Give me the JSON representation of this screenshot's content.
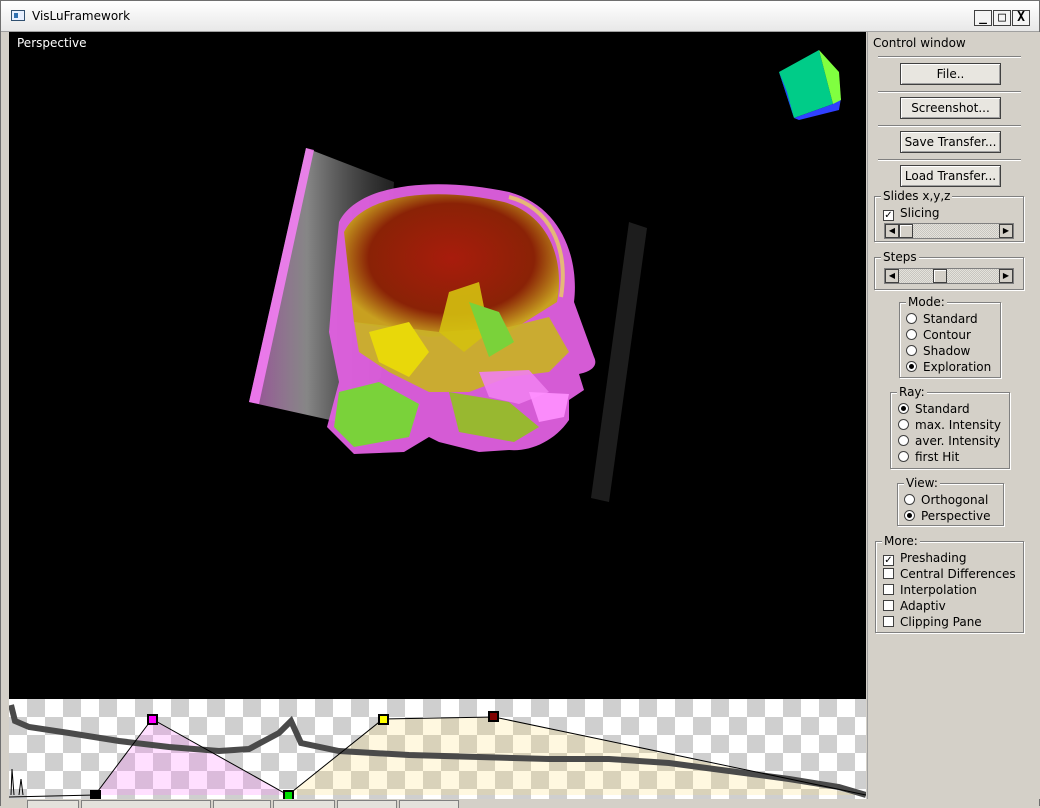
{
  "window": {
    "title": "VisLuFramework",
    "minimize": "_",
    "maximize": "□",
    "close": "X"
  },
  "viewport": {
    "label": "Perspective"
  },
  "panel": {
    "title": "Control window",
    "buttons": {
      "file": "File..",
      "screenshot": "Screenshot...",
      "save_transfer": "Save Transfer...",
      "load_transfer": "Load Transfer..."
    },
    "slides": {
      "title": "Slides x,y,z",
      "slicing_label": "Slicing",
      "slicing_checked": true,
      "slider_value": 0.0
    },
    "steps": {
      "title": "Steps",
      "slider_value": 0.42
    },
    "mode": {
      "title": "Mode:",
      "options": [
        "Standard",
        "Contour",
        "Shadow",
        "Exploration"
      ],
      "selected": "Exploration"
    },
    "ray": {
      "title": "Ray:",
      "options": [
        "Standard",
        "max. Intensity",
        "aver. Intensity",
        "first Hit"
      ],
      "selected": "Standard"
    },
    "view": {
      "title": "View:",
      "options": [
        "Orthogonal",
        "Perspective"
      ],
      "selected": "Perspective"
    },
    "more": {
      "title": "More:",
      "options": [
        "Preshading",
        "Central Differences",
        "Interpolation",
        "Adaptiv",
        "Clipping Pane"
      ],
      "checked": [
        "Preshading"
      ]
    }
  },
  "transfer_function": {
    "control_points": [
      {
        "id": "black",
        "color": "#000000"
      },
      {
        "id": "magenta",
        "color": "#ff00ff"
      },
      {
        "id": "green",
        "color": "#00dd00"
      },
      {
        "id": "yellow",
        "color": "#ffff00"
      },
      {
        "id": "darkred",
        "color": "#800000"
      }
    ]
  },
  "colors": {
    "panel": "#d4d0c8",
    "viewport_bg": "#000000"
  }
}
